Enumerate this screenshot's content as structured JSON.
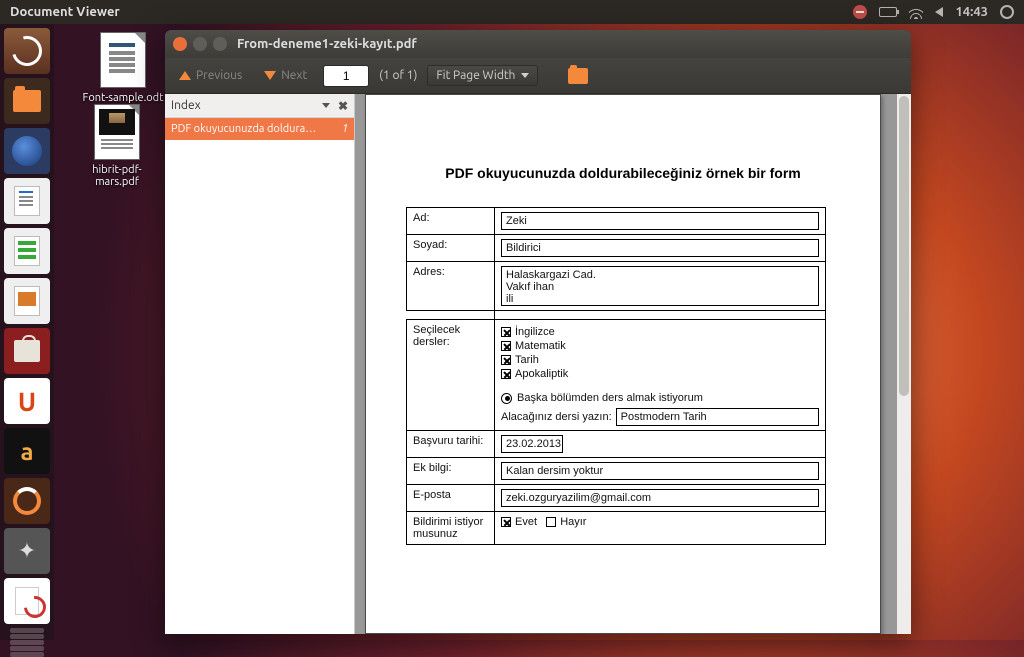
{
  "top_panel": {
    "app_title": "Document Viewer",
    "time": "14:43"
  },
  "desktop": {
    "file1": "Font-sample.odt",
    "file2": "hibrit-pdf-mars.pdf"
  },
  "window": {
    "title": "From-deneme1-zeki-kayıt.pdf",
    "toolbar": {
      "previous": "Previous",
      "next": "Next",
      "page_value": "1",
      "page_of": "(1 of 1)",
      "zoom": "Fit Page Width"
    },
    "sidebar": {
      "header": "Index",
      "item_label": "PDF okuyucunuzda doldura…",
      "item_page": "1"
    }
  },
  "form": {
    "heading": "PDF okuyucunuzda doldurabileceğiniz örnek bir form",
    "labels": {
      "ad": "Ad:",
      "soyad": "Soyad:",
      "adres": "Adres:",
      "dersler": "Seçilecek dersler:",
      "baska": "Başka bölümden ders almak istiyorum",
      "yaz": "Alacağınız dersi yazın:",
      "basvuru": "Başvuru tarihi:",
      "ek": "Ek bilgi:",
      "eposta": "E-posta",
      "bildirimi": "Bildirimi istiyor musunuz",
      "evet": "Evet",
      "hayir": "Hayır"
    },
    "values": {
      "ad": "Zeki",
      "soyad": "Bildirici",
      "adres": "Halaskargazi Cad.\nVakıf ihan\nili",
      "dersler": [
        "İngilizce",
        "Matematik",
        "Tarih",
        "Apokaliptik"
      ],
      "yazilan_ders": "Postmodern Tarih",
      "tarih": "23.02.2013",
      "ek": "Kalan dersim yoktur",
      "eposta": "zeki.ozguryazilim@gmail.com"
    }
  }
}
